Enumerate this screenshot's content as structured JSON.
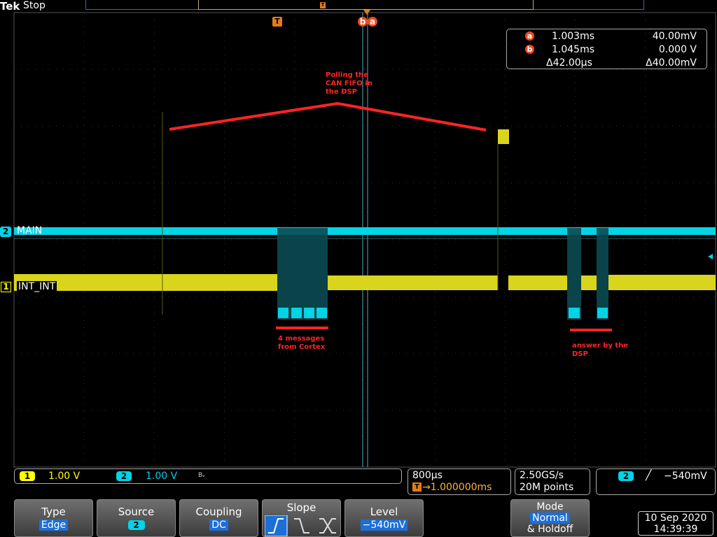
{
  "header": {
    "brand": "Tek",
    "run_state": "Stop",
    "trigger_marker": "T",
    "record_marker": "T"
  },
  "cursors": {
    "a_label": "a",
    "b_label": "b"
  },
  "readout": {
    "a": {
      "time": "1.003ms",
      "value": "40.00mV"
    },
    "b": {
      "time": "1.045ms",
      "value": "0.000 V"
    },
    "delta": {
      "time": "Δ42.00µs",
      "value": "Δ40.00mV"
    }
  },
  "channels": [
    {
      "number": "1",
      "name": "INT_INT",
      "color": "#ffff00",
      "scale": "1.00 V"
    },
    {
      "number": "2",
      "name": "MAIN",
      "color": "#00e3f0",
      "scale": "1.00 V"
    }
  ],
  "bandwidth_symbol": "Bᵥ",
  "annotations": {
    "polling": [
      "Polling the",
      "CAN FIFO in",
      "the DSP"
    ],
    "messages": [
      "4 messages",
      "from Cortex"
    ],
    "answer": [
      "answer by the",
      "DSP"
    ]
  },
  "horizontal": {
    "scale": "800µs",
    "trigger_position": "→1.000000ms",
    "trigger_icon": "T"
  },
  "acquisition": {
    "sample_rate": "2.50GS/s",
    "record_length": "20M points"
  },
  "trigger": {
    "source": "2",
    "slope_symbol": "╱",
    "level": "−540mV"
  },
  "softkeys": {
    "type": {
      "label": "Type",
      "value": "Edge"
    },
    "source": {
      "label": "Source",
      "value": "2"
    },
    "coupling": {
      "label": "Coupling",
      "value": "DC"
    },
    "slope": {
      "label": "Slope"
    },
    "level": {
      "label": "Level",
      "value": "−540mV"
    },
    "mode": {
      "label": "Mode",
      "value": "Normal",
      "suffix": "& Holdoff"
    }
  },
  "datetime": {
    "date": "10 Sep 2020",
    "time": "14:39:39"
  },
  "colors": {
    "ch1": "#ffff00",
    "ch2": "#00e3f0",
    "annotation": "#ff2424",
    "trigger": "#e47b18",
    "cursor": "#ef4a1c"
  }
}
